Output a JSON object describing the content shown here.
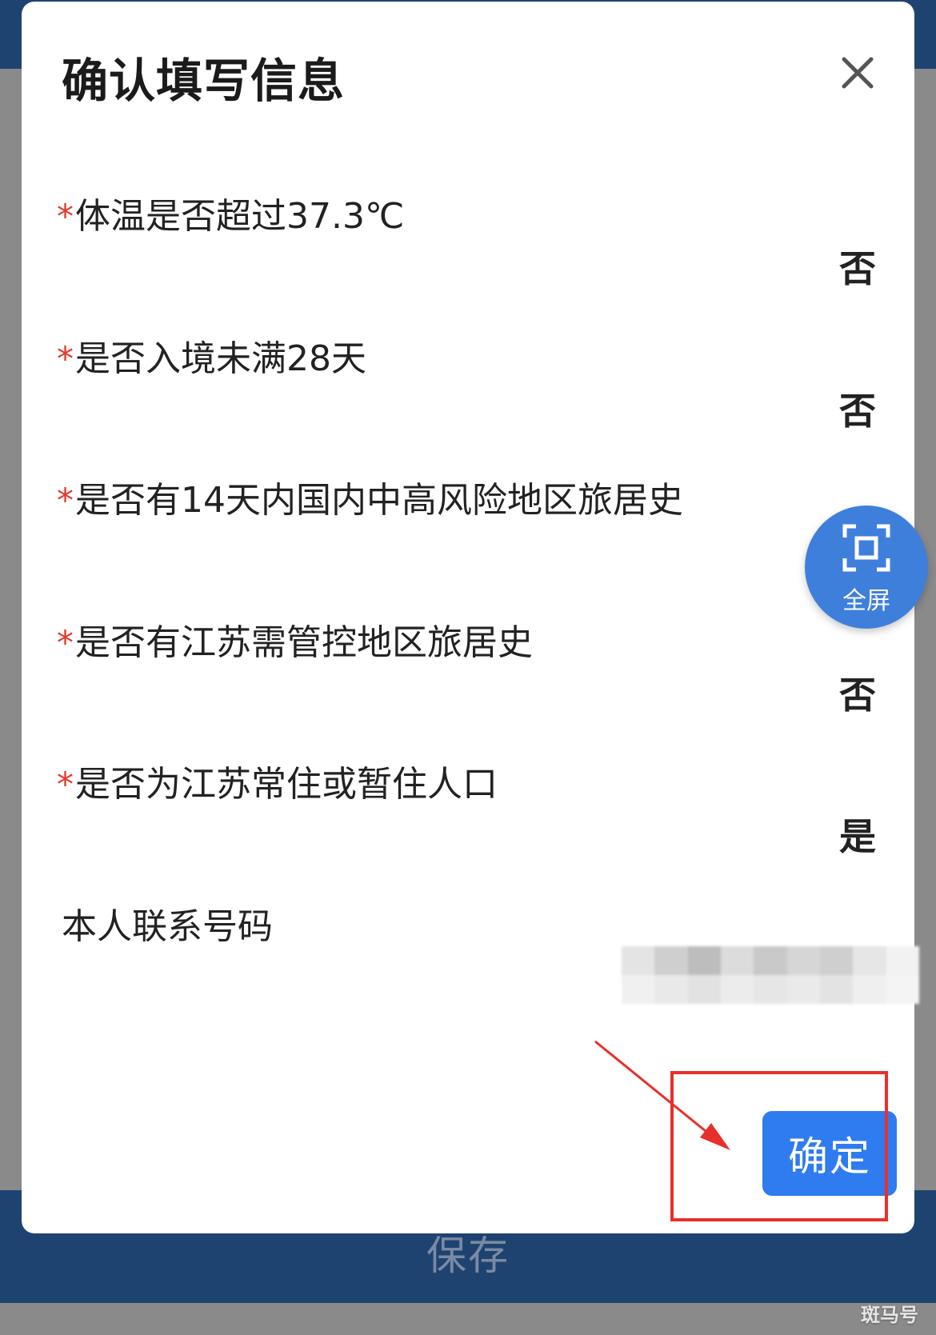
{
  "background": {
    "save_label": "保存",
    "watermark": "斑马号"
  },
  "dialog": {
    "title": "确认填写信息",
    "close_icon": "close-icon",
    "questions": [
      {
        "required_mark": "*",
        "label": "体温是否超过37.3℃",
        "value": "否"
      },
      {
        "required_mark": "*",
        "label": "是否入境未满28天",
        "value": "否"
      },
      {
        "required_mark": "*",
        "label": "是否有14天内国内中高风险地区旅居史",
        "value": ""
      },
      {
        "required_mark": "*",
        "label": "是否有江苏需管控地区旅居史",
        "value": "否"
      },
      {
        "required_mark": "*",
        "label": "是否为江苏常住或暂住人口",
        "value": "是"
      }
    ],
    "phone": {
      "label": "本人联系号码"
    },
    "confirm_label": "确定"
  },
  "fullscreen": {
    "label": "全屏",
    "icon": "fullscreen-frame-icon"
  },
  "colors": {
    "accent": "#2f7bf0",
    "required": "#e33b2e",
    "annotation": "#e8302b",
    "header_bar": "#1f4371",
    "overlay": "#8a8a8a"
  }
}
